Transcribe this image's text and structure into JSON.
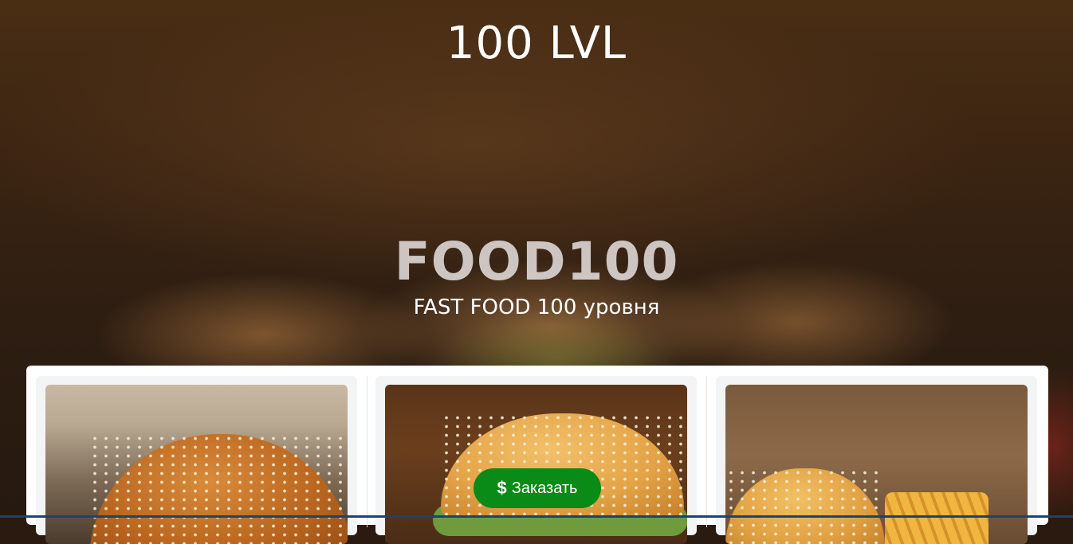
{
  "header": {
    "brand": "100 LVL"
  },
  "hero": {
    "title": "FOOD100",
    "subtitle": "FAST FOOD 100 уровня"
  },
  "products": [
    {
      "image": "burger-photo-1"
    },
    {
      "image": "burger-photo-2"
    },
    {
      "image": "burger-fries-photo"
    }
  ],
  "order_button": {
    "icon": "dollar-icon",
    "icon_glyph": "$",
    "label": "Заказать",
    "color": "#0a8a16"
  },
  "colors": {
    "accent": "#0a8a16",
    "bottom_bar": "#16447a",
    "panel": "#ffffff"
  }
}
